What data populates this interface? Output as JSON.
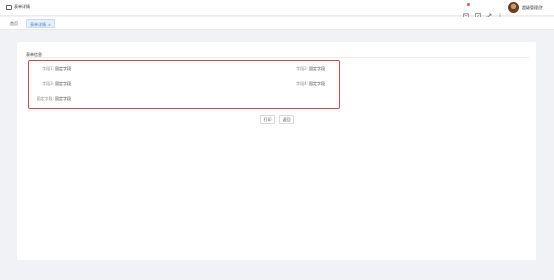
{
  "header": {
    "title": "表单详情",
    "user_name": "超级管理员",
    "icons": [
      "message-icon",
      "fullscreen-icon",
      "expand-icon",
      "more-icon"
    ]
  },
  "tabs": [
    {
      "label": "首页",
      "active": false
    },
    {
      "label": "表单详情",
      "active": true,
      "close": "×"
    }
  ],
  "panel": {
    "title": "表单信息",
    "fields": [
      {
        "label": "字段1:",
        "value": "固定字段"
      },
      {
        "label": "字段2:",
        "value": "固定字段"
      },
      {
        "label": "字段3:",
        "value": "固定字段"
      },
      {
        "label": "字段4:",
        "value": "固定字段"
      },
      {
        "label": "固定字段:",
        "value": "固定字段"
      }
    ]
  },
  "actions": {
    "print": "打印",
    "back": "返回"
  },
  "colors": {
    "highlight": "#e84040",
    "accent": "#4a7bd0",
    "badge": "#ff4d4f"
  }
}
